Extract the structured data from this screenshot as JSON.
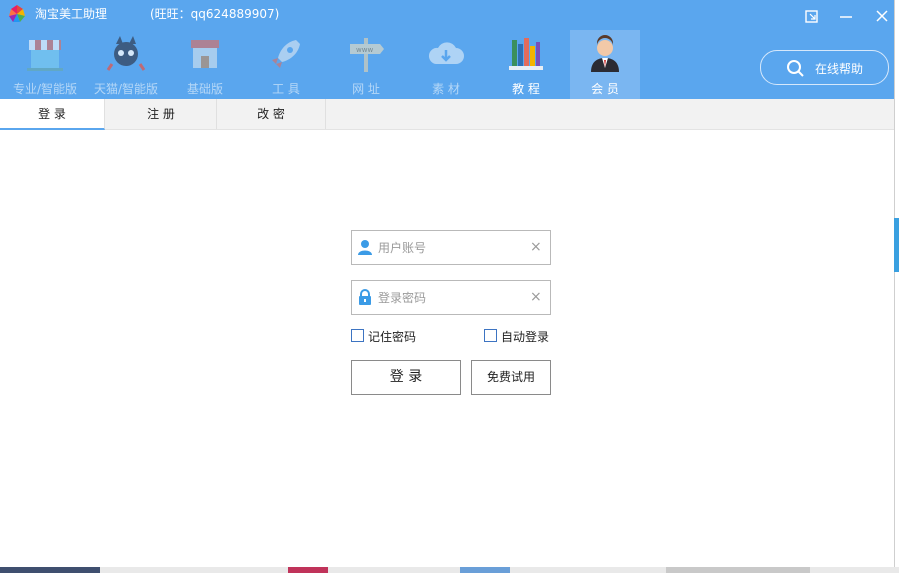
{
  "app": {
    "title": "淘宝美工助理",
    "contact": "(旺旺：qq624889907)"
  },
  "nav": [
    {
      "label": "专业/智能版",
      "icon": "market-stall-icon"
    },
    {
      "label": "天猫/智能版",
      "icon": "tmall-cat-icon"
    },
    {
      "label": "基础版",
      "icon": "shop-icon"
    },
    {
      "label": "工  具",
      "icon": "rocket-icon"
    },
    {
      "label": "网  址",
      "icon": "www-signpost-icon"
    },
    {
      "label": "素  材",
      "icon": "cloud-download-icon"
    },
    {
      "label": "教  程",
      "icon": "bookshelf-icon"
    },
    {
      "label": "会  员",
      "icon": "member-avatar-icon"
    }
  ],
  "nav_active": "会  员",
  "help_button": {
    "label": "在线帮助"
  },
  "tabs": [
    {
      "label": "登  录"
    },
    {
      "label": "注  册"
    },
    {
      "label": "改  密"
    }
  ],
  "login": {
    "username_placeholder": "用户账号",
    "password_placeholder": "登录密码",
    "clear_glyph": "×",
    "remember_label": "记住密码",
    "autologin_label": "自动登录",
    "login_button": "登  录",
    "trial_button": "免费试用"
  },
  "colors": {
    "topbar": "#5aa6ee",
    "active_nav": "#7ab6f1",
    "checkbox_border": "#3d74c2"
  }
}
